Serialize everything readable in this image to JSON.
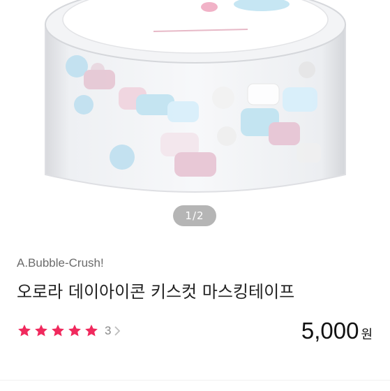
{
  "gallery": {
    "page_indicator": "1/2",
    "image_alt": "aurora day icon kiss-cut masking tape roll"
  },
  "product": {
    "brand": "A.Bubble-Crush!",
    "title": "오로라 데이아이콘 키스컷 마스킹테이프",
    "rating": {
      "stars": 5,
      "count": "3"
    },
    "price": {
      "value": "5,000",
      "unit": "원"
    }
  },
  "colors": {
    "star": "#f0295d",
    "indicator_bg": "#8a8a8a"
  },
  "icons": {
    "star": "star-icon",
    "chevron": "chevron-right-icon"
  }
}
